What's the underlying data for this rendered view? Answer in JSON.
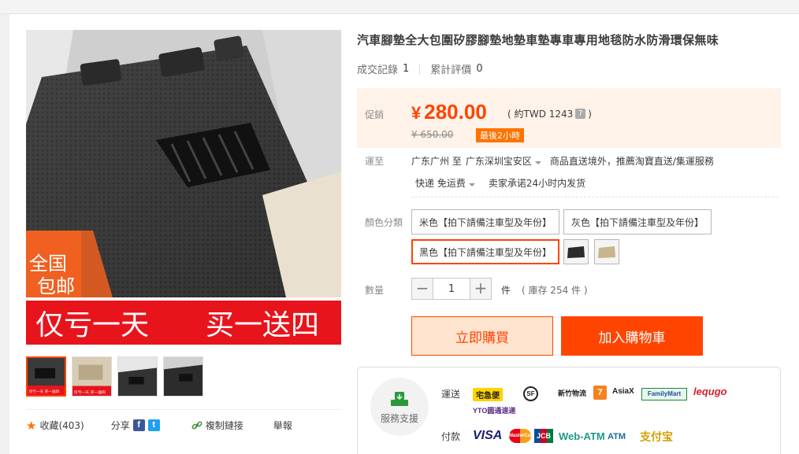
{
  "product": {
    "title": "汽車腳墊全大包圍矽膠腳墊地墊車墊專車專用地毯防水防滑環保無味",
    "sales_label": "成交記錄",
    "sales_count": "1",
    "reviews_label": "累計評價",
    "reviews_count": "0"
  },
  "image": {
    "badge_line1": "全国",
    "badge_line2": "包邮",
    "banner_left": "仅亏一天",
    "banner_right": "买一送四",
    "thumb_caption": "仅亏一天 买一送四"
  },
  "price": {
    "label": "促銷",
    "currency": "¥",
    "amount": "280.00",
    "approx": "( 約TWD 1243",
    "approx_close": ")",
    "help": "?",
    "original": "¥ 650.00",
    "promo": "最後2小時"
  },
  "shipping": {
    "label": "運至",
    "from": "广东广州 至",
    "to": "广东深圳宝安区",
    "note": "商品直送境外，推薦淘寶直送/集運服務",
    "method": "快递 免运费",
    "promise": "卖家承诺24小时内发货"
  },
  "color": {
    "label": "顏色分類",
    "options": [
      "米色【拍下請備注車型及年份】",
      "灰色【拍下請備注車型及年份】",
      "黑色【拍下請備注車型及年份】"
    ],
    "selected": "黑色【拍下請備注車型及年份】"
  },
  "quantity": {
    "label": "數量",
    "value": "1",
    "minus": "−",
    "plus": "+",
    "unit": "件",
    "stock": "( 庫存 254 件 )"
  },
  "actions": {
    "buy_now": "立即購買",
    "add_to_cart": "加入購物車"
  },
  "social": {
    "favorite": "收藏(403)",
    "share": "分享",
    "fb": "f",
    "tw": "t",
    "copy_link": "複制鏈接",
    "report": "舉報"
  },
  "service": {
    "label": "服務支援",
    "shipping_label": "運送",
    "payment_label": "付款",
    "shipping_logos": [
      "宅急便",
      "SF",
      "新竹物流",
      "7-ELEVEn",
      "AsiaX",
      "FamilyMart",
      "lequgo",
      "YTO圆通速递"
    ],
    "payment_logos": [
      "VISA",
      "MasterCard",
      "JCB",
      "Web-ATM",
      "ATM",
      "支付宝"
    ]
  },
  "colors": {
    "accent": "#ff4400",
    "price_bg": "#fff2e8",
    "promo_orange": "#ff7300"
  }
}
